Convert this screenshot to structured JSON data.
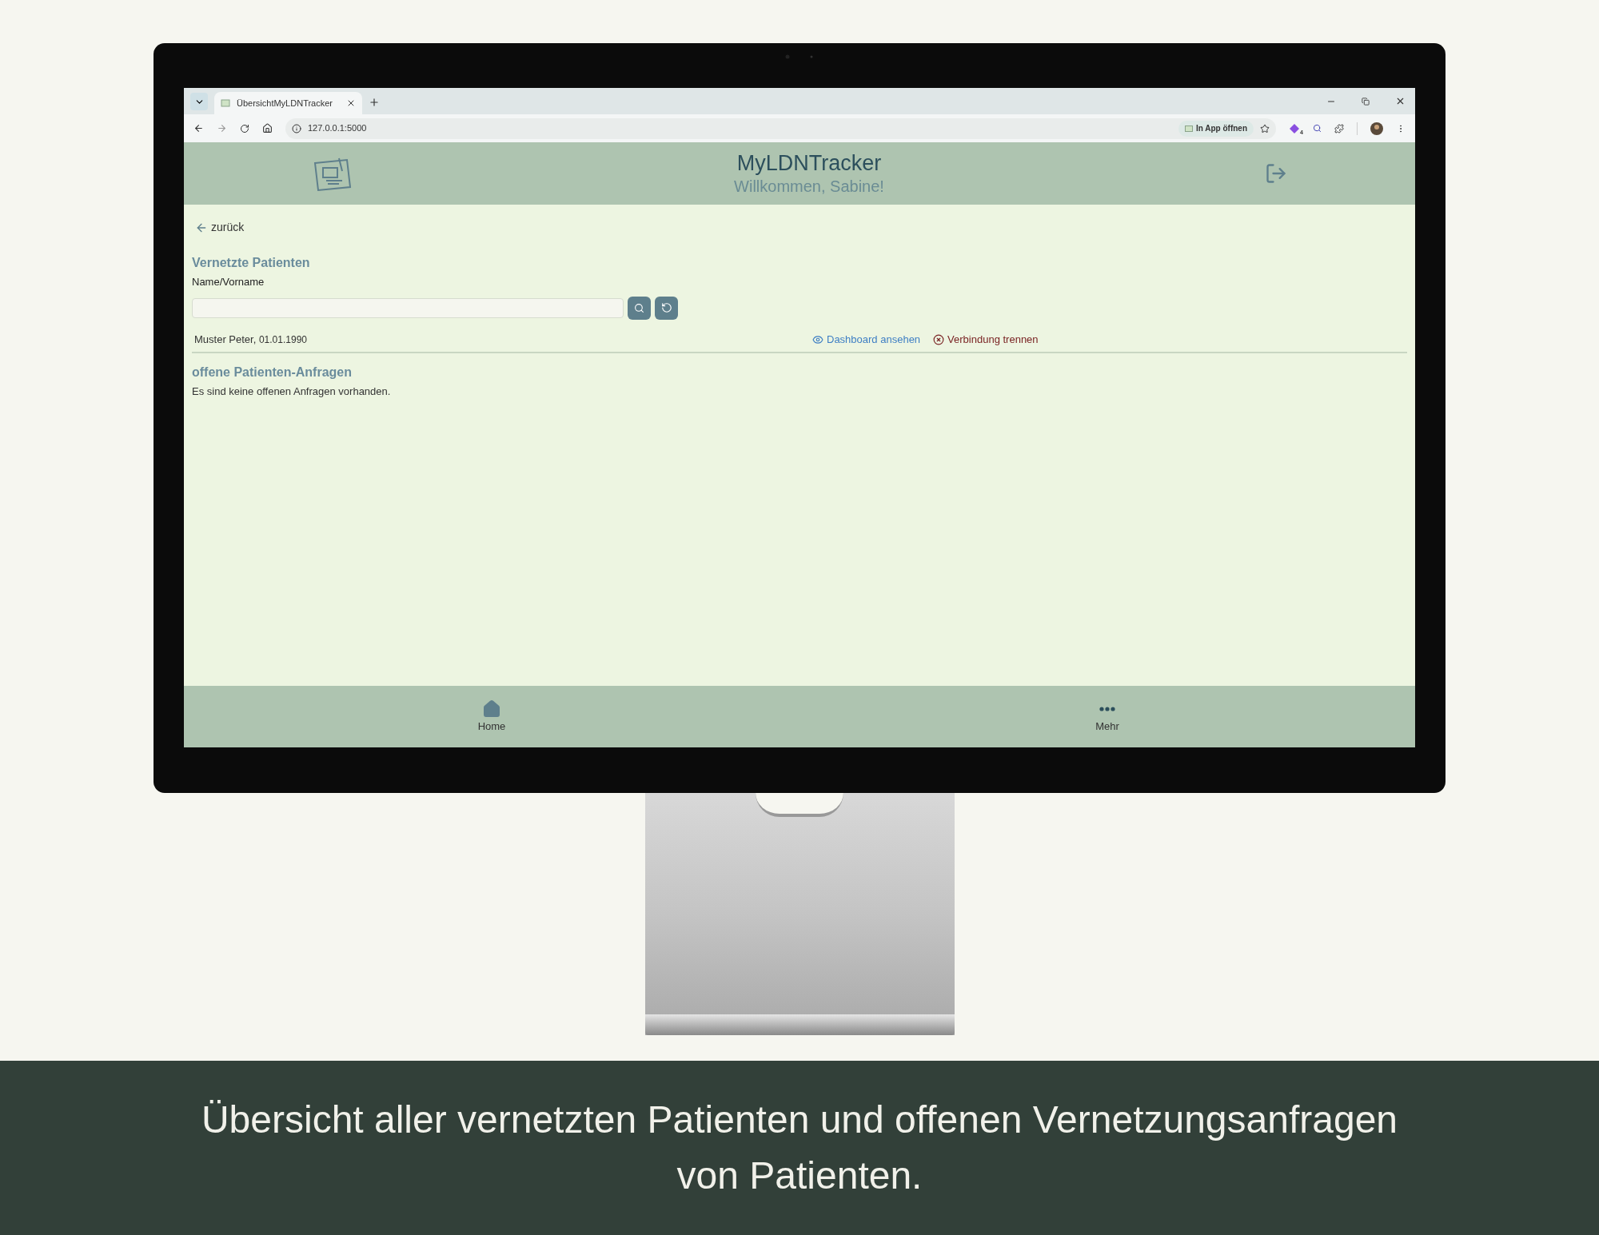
{
  "browser": {
    "tab_title": "ÜbersichtMyLDNTracker",
    "url": "127.0.0.1:5000",
    "open_in_app": "In App öffnen",
    "extension_badge": "4"
  },
  "app": {
    "title": "MyLDNTracker",
    "greeting": "Willkommen, Sabine!"
  },
  "back_link": "zurück",
  "connected_patients": {
    "title": "Vernetzte Patienten",
    "field_label": "Name/Vorname",
    "rows": [
      {
        "name": "Muster Peter,",
        "birthdate": "01.01.1990",
        "actions": [
          {
            "kind": "view",
            "label": "Dashboard ansehen"
          },
          {
            "kind": "disconnect",
            "label": "Verbindung trennen"
          }
        ]
      }
    ]
  },
  "open_requests": {
    "title": "offene Patienten-Anfragen",
    "empty_message": "Es sind keine offenen Anfragen vorhanden."
  },
  "bottom_nav": [
    {
      "kind": "home",
      "label": "Home"
    },
    {
      "kind": "more",
      "label": "Mehr"
    }
  ],
  "caption": "Übersicht aller vernetzten Patienten und offenen Vernetzungsanfragen von Patienten."
}
